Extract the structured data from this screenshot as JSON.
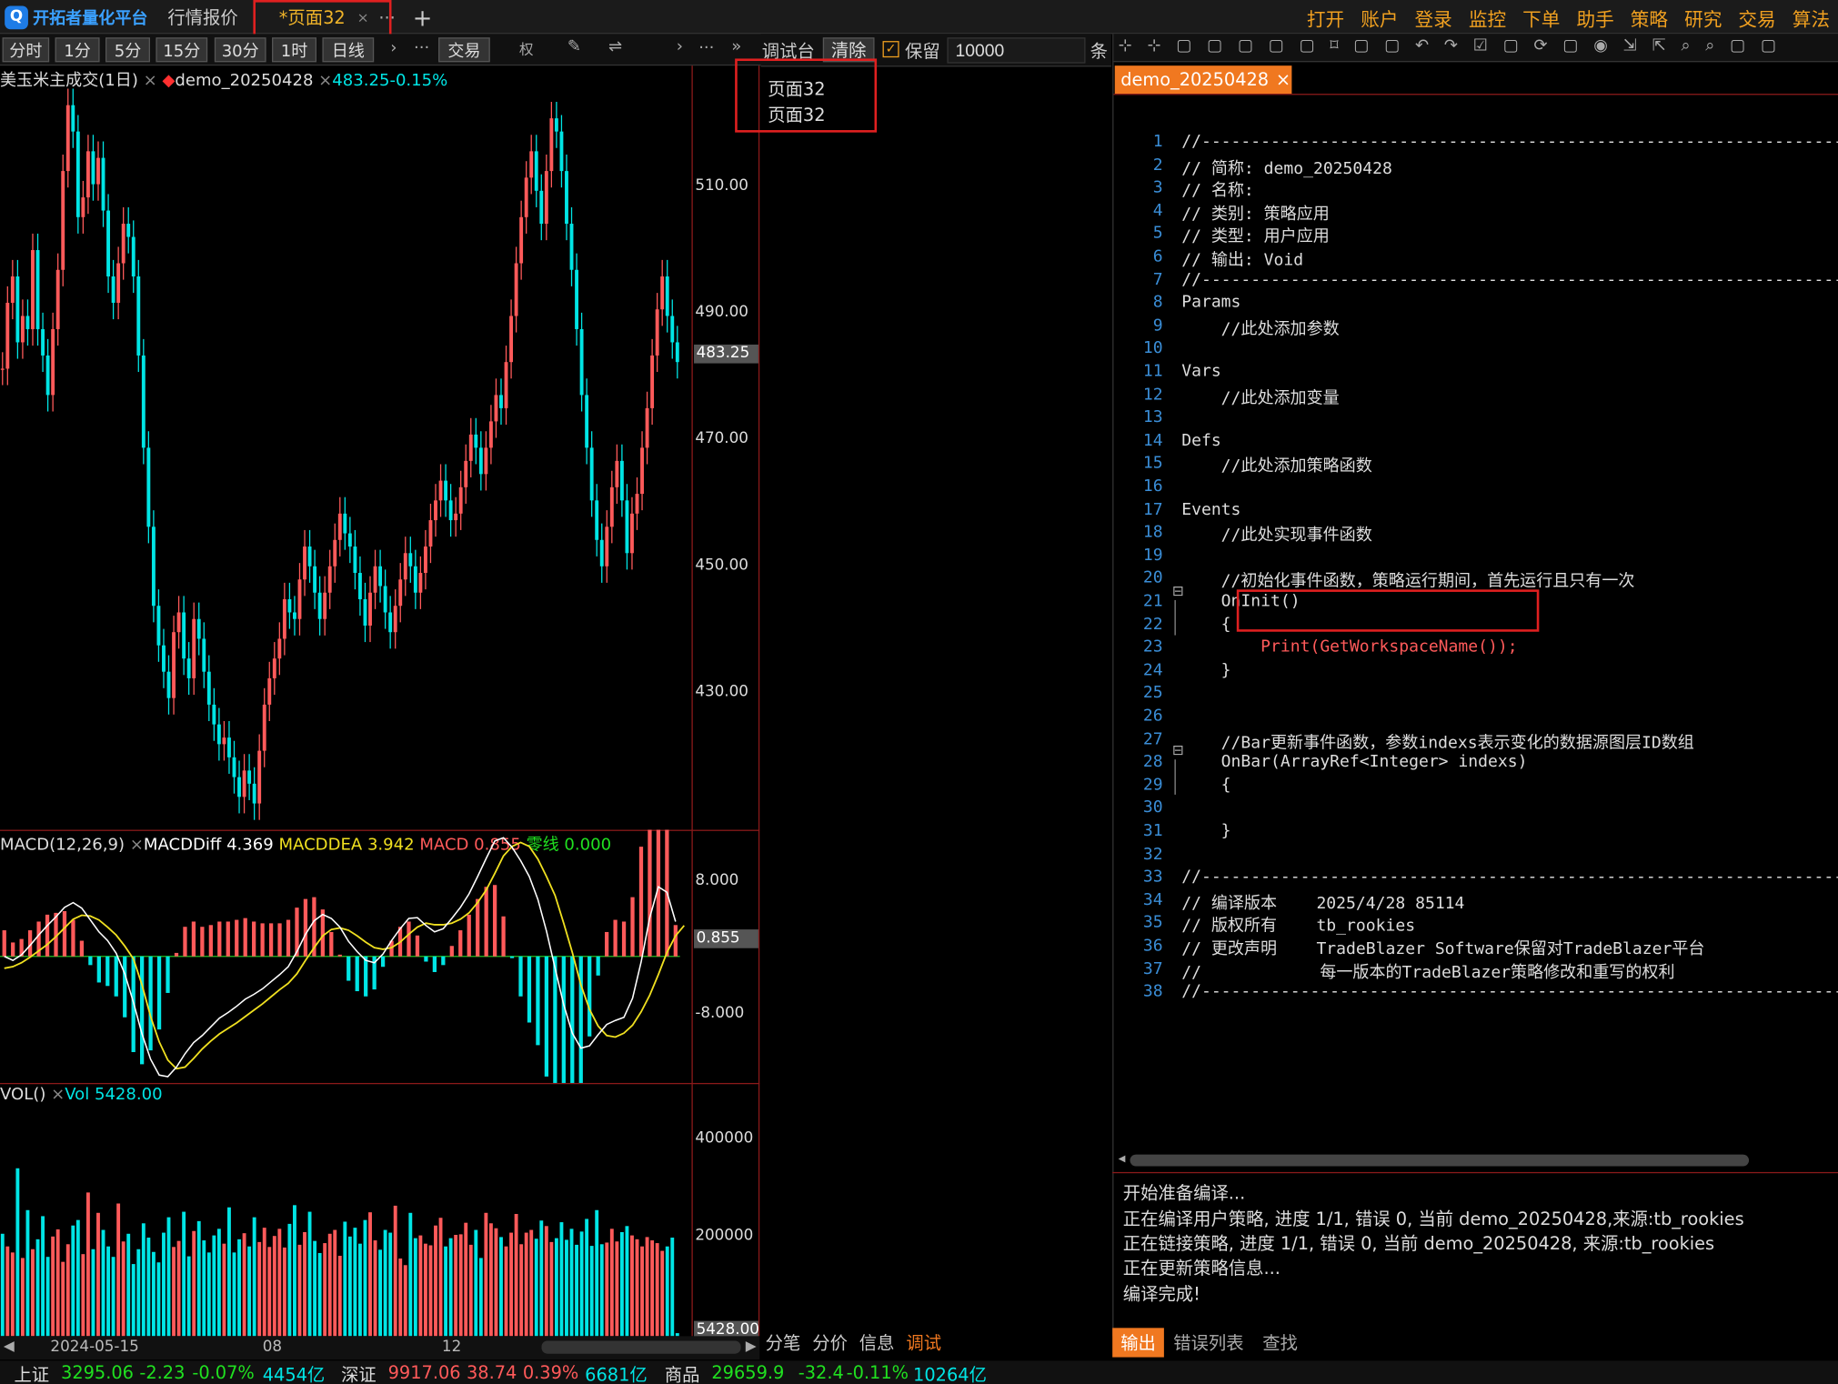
{
  "app": {
    "logo": "开拓者量化平台",
    "logo_glyph": "Q"
  },
  "tabs": [
    {
      "label": "行情报价"
    },
    {
      "label": "*页面32",
      "close": "×"
    }
  ],
  "tab_more": "···",
  "tab_add": "+",
  "menu": [
    "打开",
    "账户",
    "登录",
    "监控",
    "下单",
    "助手",
    "策略",
    "研究",
    "交易",
    "算法"
  ],
  "periods": [
    "分时",
    "1分",
    "5分",
    "15分",
    "30分",
    "1时",
    "日线"
  ],
  "chart_toolbar": {
    "more": "···",
    "trade": "交易",
    "right": "权",
    "more2": "···",
    "expand": "»"
  },
  "debug": {
    "title": "调试台",
    "clear": "清除",
    "keep_label": "保留",
    "keep_checked": true,
    "count_value": "10000",
    "count_unit": "条",
    "lines": [
      "页面32",
      "页面32"
    ]
  },
  "chart": {
    "title_symbol": "美玉米主成交(1日)",
    "title_strategy": "demo_20250428",
    "title_price": "483.25-0.15%",
    "price_axis": [
      "510.00",
      "490.00",
      "470.00",
      "450.00",
      "430.00"
    ],
    "last_price": "483.25",
    "macd": {
      "title": "MACD(12,26,9)",
      "diff": "MACDDiff 4.369",
      "dea": "MACDDEA 3.942",
      "macd": "MACD 0.855",
      "zero": "零线 0.000",
      "axis": [
        "8.000",
        "-8.000"
      ],
      "last": "0.855"
    },
    "vol": {
      "title": "VOL()",
      "vol": "Vol 5428.00",
      "axis": [
        "400000",
        "200000"
      ],
      "last": "5428.00"
    },
    "time_axis": [
      "2024-05-15",
      "08",
      "12"
    ]
  },
  "chart_data": [
    {
      "type": "candlestick",
      "title": "美玉米主成交(1日)",
      "ylim": [
        412,
        528
      ],
      "series": [
        {
          "name": "demo_20250428",
          "close": [
            482,
            492,
            496,
            486,
            490,
            488,
            500,
            488,
            484,
            478,
            488,
            497,
            512,
            522,
            518,
            505,
            508,
            515,
            510,
            514,
            506,
            496,
            492,
            498,
            504,
            502,
            496,
            484,
            470,
            458,
            446,
            440,
            436,
            432,
            442,
            445,
            438,
            435,
            444,
            441,
            436,
            431,
            428,
            425,
            426,
            423,
            420,
            417,
            421,
            419,
            416,
            424,
            431,
            435,
            438,
            441,
            447,
            445,
            444,
            450,
            455,
            452,
            448,
            444,
            448,
            452,
            456,
            460,
            457,
            455,
            451,
            447,
            443,
            448,
            452,
            449,
            445,
            442,
            446,
            450,
            454,
            452,
            448,
            451,
            455,
            459,
            462,
            465,
            462,
            459,
            460,
            464,
            468,
            472,
            470,
            466,
            470,
            474,
            478,
            476,
            483,
            490,
            498,
            505,
            511,
            515,
            509,
            504,
            512,
            520,
            518,
            512,
            504,
            497,
            488,
            478,
            470,
            462,
            456,
            452,
            458,
            464,
            468,
            462,
            454,
            460,
            463,
            470,
            476,
            484,
            491,
            496,
            490,
            486,
            483
          ]
        }
      ]
    },
    {
      "type": "line",
      "title": "MACD(12,26,9)",
      "ylim": [
        -16,
        16
      ],
      "series": [
        {
          "name": "MACDDiff",
          "values": [
            0,
            -0.5,
            0.2,
            1.4,
            2.7,
            3.9,
            5,
            6.2,
            6.8,
            6.1,
            4.6,
            3.1,
            2,
            0.4,
            -2.2,
            -5.8,
            -9.8,
            -13,
            -15,
            -15.2,
            -14,
            -12.3,
            -10.9,
            -10,
            -8.9,
            -7.8,
            -7.1,
            -6.3,
            -5.4,
            -4.8,
            -4.1,
            -3.2,
            -2.3,
            -1.3,
            0.6,
            2.8,
            4.5,
            5.3,
            4.8,
            3.7,
            1.9,
            0.6,
            -0.5,
            -0.8,
            0.3,
            2,
            3.5,
            4.8,
            4.9,
            3.9,
            3.1,
            3.5,
            4.8,
            6.2,
            7.9,
            10.1,
            12.4,
            14.6,
            15,
            13.8,
            12.1,
            10.1,
            7.2,
            3.2,
            -1.5,
            -6.1,
            -9.7,
            -11.6,
            -11.3,
            -9.9,
            -8.6,
            -8.1,
            -7.7,
            -5.3,
            -0.7,
            4.9,
            8.8,
            8.1,
            4.4
          ]
        },
        {
          "name": "MACDDEA",
          "values": [
            -1.5,
            -1.3,
            -0.8,
            -0.1,
            0.7,
            1.5,
            2.5,
            3.6,
            4.7,
            5.2,
            5.1,
            4.6,
            3.7,
            2.7,
            1.3,
            -0.3,
            -3.6,
            -7.6,
            -10.8,
            -13.1,
            -14.2,
            -14,
            -12.9,
            -11.7,
            -10.7,
            -9.8,
            -9.1,
            -8.4,
            -7.6,
            -6.8,
            -6,
            -5.1,
            -4.2,
            -3.4,
            -2.2,
            -0.5,
            1.1,
            2.6,
            3.4,
            3.6,
            3.3,
            2.6,
            1.8,
            1.1,
            0.9,
            1.1,
            1.8,
            2.8,
            3.7,
            4.2,
            4,
            4,
            4.2,
            4.7,
            5.5,
            6.8,
            8.4,
            10.5,
            12.7,
            13.9,
            14.4,
            13.9,
            12.3,
            10.1,
            7.7,
            4.2,
            0.5,
            -3.6,
            -6.7,
            -8.8,
            -10,
            -10.2,
            -9.7,
            -8.7,
            -7,
            -4.9,
            -2.3,
            0.5,
            2.6,
            3.9
          ]
        }
      ]
    },
    {
      "type": "bar",
      "title": "VOL()",
      "ylim": [
        0,
        460000
      ],
      "series": [
        {
          "name": "Vol",
          "values": [
            186000,
            163000,
            152000,
            305000,
            142000,
            229000,
            158000,
            176000,
            218000,
            144000,
            181000,
            194000,
            135000,
            167000,
            201000,
            211000,
            149000,
            261000,
            158000,
            224000,
            193000,
            163000,
            144000,
            241000,
            172000,
            186000,
            131000,
            158000,
            205000,
            179000,
            153000,
            134000,
            188000,
            216000,
            162000,
            173000,
            226000,
            145000,
            191000,
            209000,
            174000,
            152000,
            183000,
            195000,
            168000,
            234000,
            152000,
            176000,
            187000,
            163000,
            216000,
            171000,
            197000,
            162000,
            182000,
            195000,
            161000,
            204000,
            238000,
            166000,
            189000,
            226000,
            173000,
            151000,
            169000,
            186000,
            193000,
            146000,
            208000,
            181000,
            197000,
            168000,
            211000,
            225000,
            174000,
            157000,
            193000,
            188000,
            237000,
            141000,
            129000,
            224000,
            178000,
            183000,
            168000,
            165000,
            201000,
            215000,
            163000,
            178000,
            184000,
            185000,
            206000,
            166000,
            193000,
            142000,
            224000,
            205000,
            196000,
            180000,
            163000,
            188000,
            222000,
            167000,
            188000,
            193000,
            177000,
            210000,
            200000,
            171000,
            178000,
            207000,
            175000,
            195000,
            166000,
            190000,
            213000,
            164000,
            229000,
            167000,
            170000,
            195000,
            172000,
            189000,
            200000,
            183000,
            176000,
            163000,
            180000,
            174000,
            169000,
            155000,
            163000,
            179000,
            5428
          ]
        }
      ]
    }
  ],
  "editor": {
    "tab": "demo_20250428",
    "tab_close": "×",
    "lines": [
      {
        "n": "1",
        "t": "//------------------------------------------------------------------------",
        "c": "cm"
      },
      {
        "n": "2",
        "t": "// 简称: demo_20250428",
        "c": "cm"
      },
      {
        "n": "3",
        "t": "// 名称:",
        "c": "cm"
      },
      {
        "n": "4",
        "t": "// 类别: 策略应用",
        "c": "cm"
      },
      {
        "n": "5",
        "t": "// 类型: 用户应用",
        "c": "cm"
      },
      {
        "n": "6",
        "t": "// 输出: Void",
        "c": "cm"
      },
      {
        "n": "7",
        "t": "//------------------------------------------------------------------------",
        "c": "cm"
      },
      {
        "n": "8",
        "t": "Params",
        "c": "kw"
      },
      {
        "n": "9",
        "t": "    //此处添加参数",
        "c": "cm"
      },
      {
        "n": "10",
        "t": "",
        "c": ""
      },
      {
        "n": "11",
        "t": "Vars",
        "c": "kw"
      },
      {
        "n": "12",
        "t": "    //此处添加变量",
        "c": "cm"
      },
      {
        "n": "13",
        "t": "",
        "c": ""
      },
      {
        "n": "14",
        "t": "Defs",
        "c": "kw"
      },
      {
        "n": "15",
        "t": "    //此处添加策略函数",
        "c": "cm"
      },
      {
        "n": "16",
        "t": "",
        "c": ""
      },
      {
        "n": "17",
        "t": "Events",
        "c": "kw"
      },
      {
        "n": "18",
        "t": "    //此处实现事件函数",
        "c": "cm"
      },
      {
        "n": "19",
        "t": "",
        "c": ""
      },
      {
        "n": "20",
        "t": "    //初始化事件函数，策略运行期间，首先运行且只有一次",
        "c": "cm"
      },
      {
        "n": "21",
        "t": "    OnInit()",
        "c": "fn"
      },
      {
        "n": "22",
        "t": "    {",
        "c": ""
      },
      {
        "n": "23",
        "t": "        Print(GetWorkspaceName());",
        "c": ""
      },
      {
        "n": "24",
        "t": "    }",
        "c": ""
      },
      {
        "n": "25",
        "t": "",
        "c": ""
      },
      {
        "n": "26",
        "t": "",
        "c": ""
      },
      {
        "n": "27",
        "t": "    //Bar更新事件函数，参数indexs表示变化的数据源图层ID数组",
        "c": "cm"
      },
      {
        "n": "28",
        "t": "    OnBar(ArrayRef<Integer> indexs)",
        "c": "fn2"
      },
      {
        "n": "29",
        "t": "    {",
        "c": ""
      },
      {
        "n": "30",
        "t": "",
        "c": ""
      },
      {
        "n": "31",
        "t": "    }",
        "c": ""
      },
      {
        "n": "32",
        "t": "",
        "c": ""
      },
      {
        "n": "33",
        "t": "//------------------------------------------------------------------------",
        "c": "cm"
      },
      {
        "n": "34",
        "t": "// 编译版本    2025/4/28 85114",
        "c": "cm"
      },
      {
        "n": "35",
        "t": "// 版权所有    tb_rookies",
        "c": "cm"
      },
      {
        "n": "36",
        "t": "// 更改声明    TradeBlazer Software保留对TradeBlazer平台",
        "c": "cm"
      },
      {
        "n": "37",
        "t": "//            每一版本的TradeBlazer策略修改和重写的权利",
        "c": "cm"
      },
      {
        "n": "38",
        "t": "//------------------------------------------------------------------------",
        "c": "cm"
      }
    ],
    "fold_marks": [
      "⊟",
      "⊟"
    ],
    "scroll_left": "◂"
  },
  "output": {
    "lines": [
      "开始准备编译...",
      "正在编译用户策略, 进度 1/1, 错误 0, 当前 demo_20250428,来源:tb_rookies",
      "正在链接策略, 进度 1/1, 错误 0, 当前 demo_20250428, 来源:tb_rookies",
      "正在更新策略信息...",
      "编译完成!"
    ],
    "tabs": [
      "输出",
      "错误列表",
      "查找"
    ]
  },
  "debug_tabs": [
    "分笔",
    "分价",
    "信息",
    "调试"
  ],
  "status": [
    {
      "label": "上证",
      "price": "3295.06",
      "chg": "-2.23",
      "pct": "-0.07%",
      "amt": "4454亿"
    },
    {
      "label": "深证",
      "price": "9917.06",
      "chg": "38.74",
      "pct": "0.39%",
      "amt": "6681亿"
    },
    {
      "label": "商品",
      "price": "29659.9",
      "chg": "-32.4",
      "pct": "-0.11%",
      "amt": "10264亿"
    }
  ],
  "colors": {
    "up": "#ff5a5a",
    "down": "#00e5e5",
    "accent": "#f0a020",
    "frame": "#8b1a1a"
  }
}
